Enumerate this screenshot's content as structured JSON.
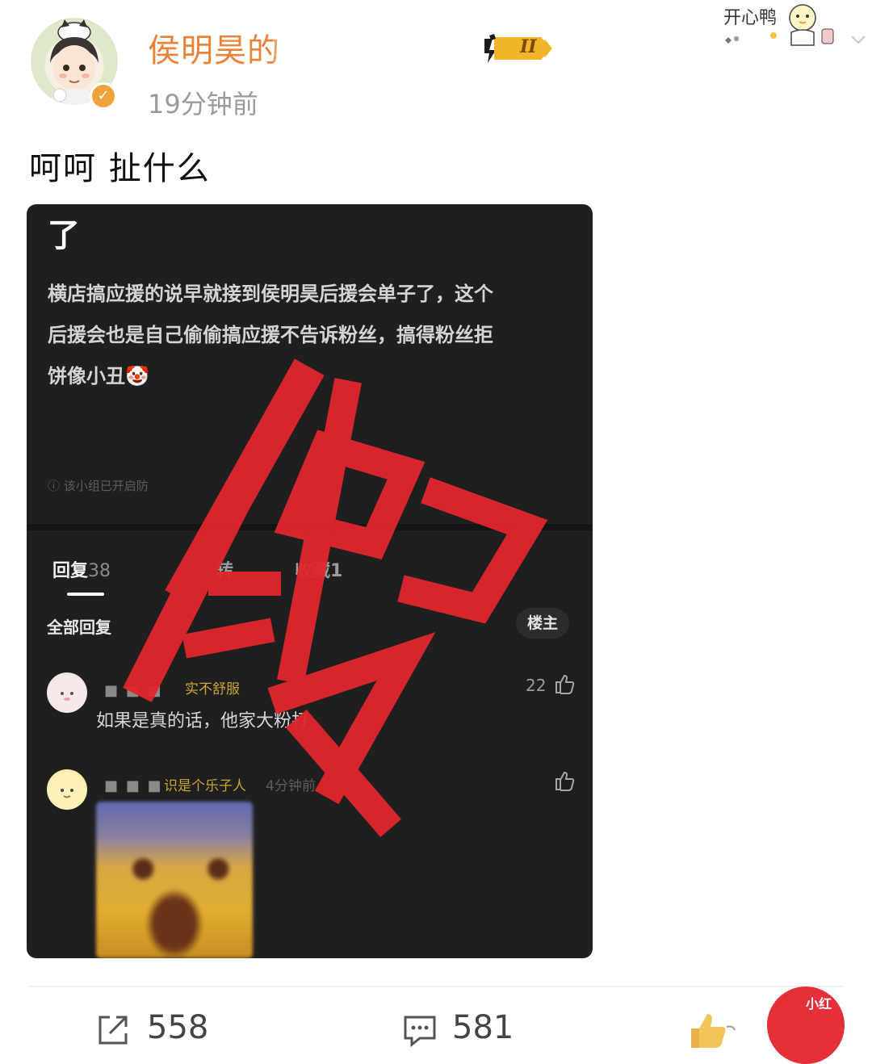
{
  "header": {
    "username": "侯明昊的",
    "timestamp": "19分钟前",
    "rank_badge_text": "II",
    "sticker_text": "开心鸭"
  },
  "post": {
    "text": "呵呵 扯什么"
  },
  "embedded": {
    "top_fragment": "了",
    "body_lines": [
      "横店搞应援的说早就接到侯明昊后援会单子了，这个",
      "后援会也是自己偷偷搞应援不告诉粉丝，搞得粉丝拒",
      "饼像小丑🤡"
    ],
    "hint": "ⓘ 该小组已开启防",
    "tabs": [
      {
        "label": "回复",
        "count": "38"
      },
      {
        "label": "转",
        "count": ""
      },
      {
        "label": "收藏",
        "count": "1"
      }
    ],
    "all_replies_label": "全部回复",
    "op_button": "楼主",
    "comments": [
      {
        "user_mask": "■ ■ ■",
        "tag": "实不舒服",
        "time": "分钟前",
        "text": "如果是真的话，他家大粉打",
        "likes": "22"
      },
      {
        "user_mask": "■ ■ ■",
        "tag": "识是个乐子人",
        "time": "4分钟前",
        "text": "",
        "likes": ""
      }
    ],
    "stamp_char": "假",
    "stamp_color": "#e0262d"
  },
  "actions": {
    "repost_count": "558",
    "comment_count": "581",
    "mini_label": "小红"
  },
  "colors": {
    "username": "#e9833a",
    "verified": "#f2a23a",
    "badge_gold": "#f0b529",
    "dark_card": "#1f1f20"
  }
}
